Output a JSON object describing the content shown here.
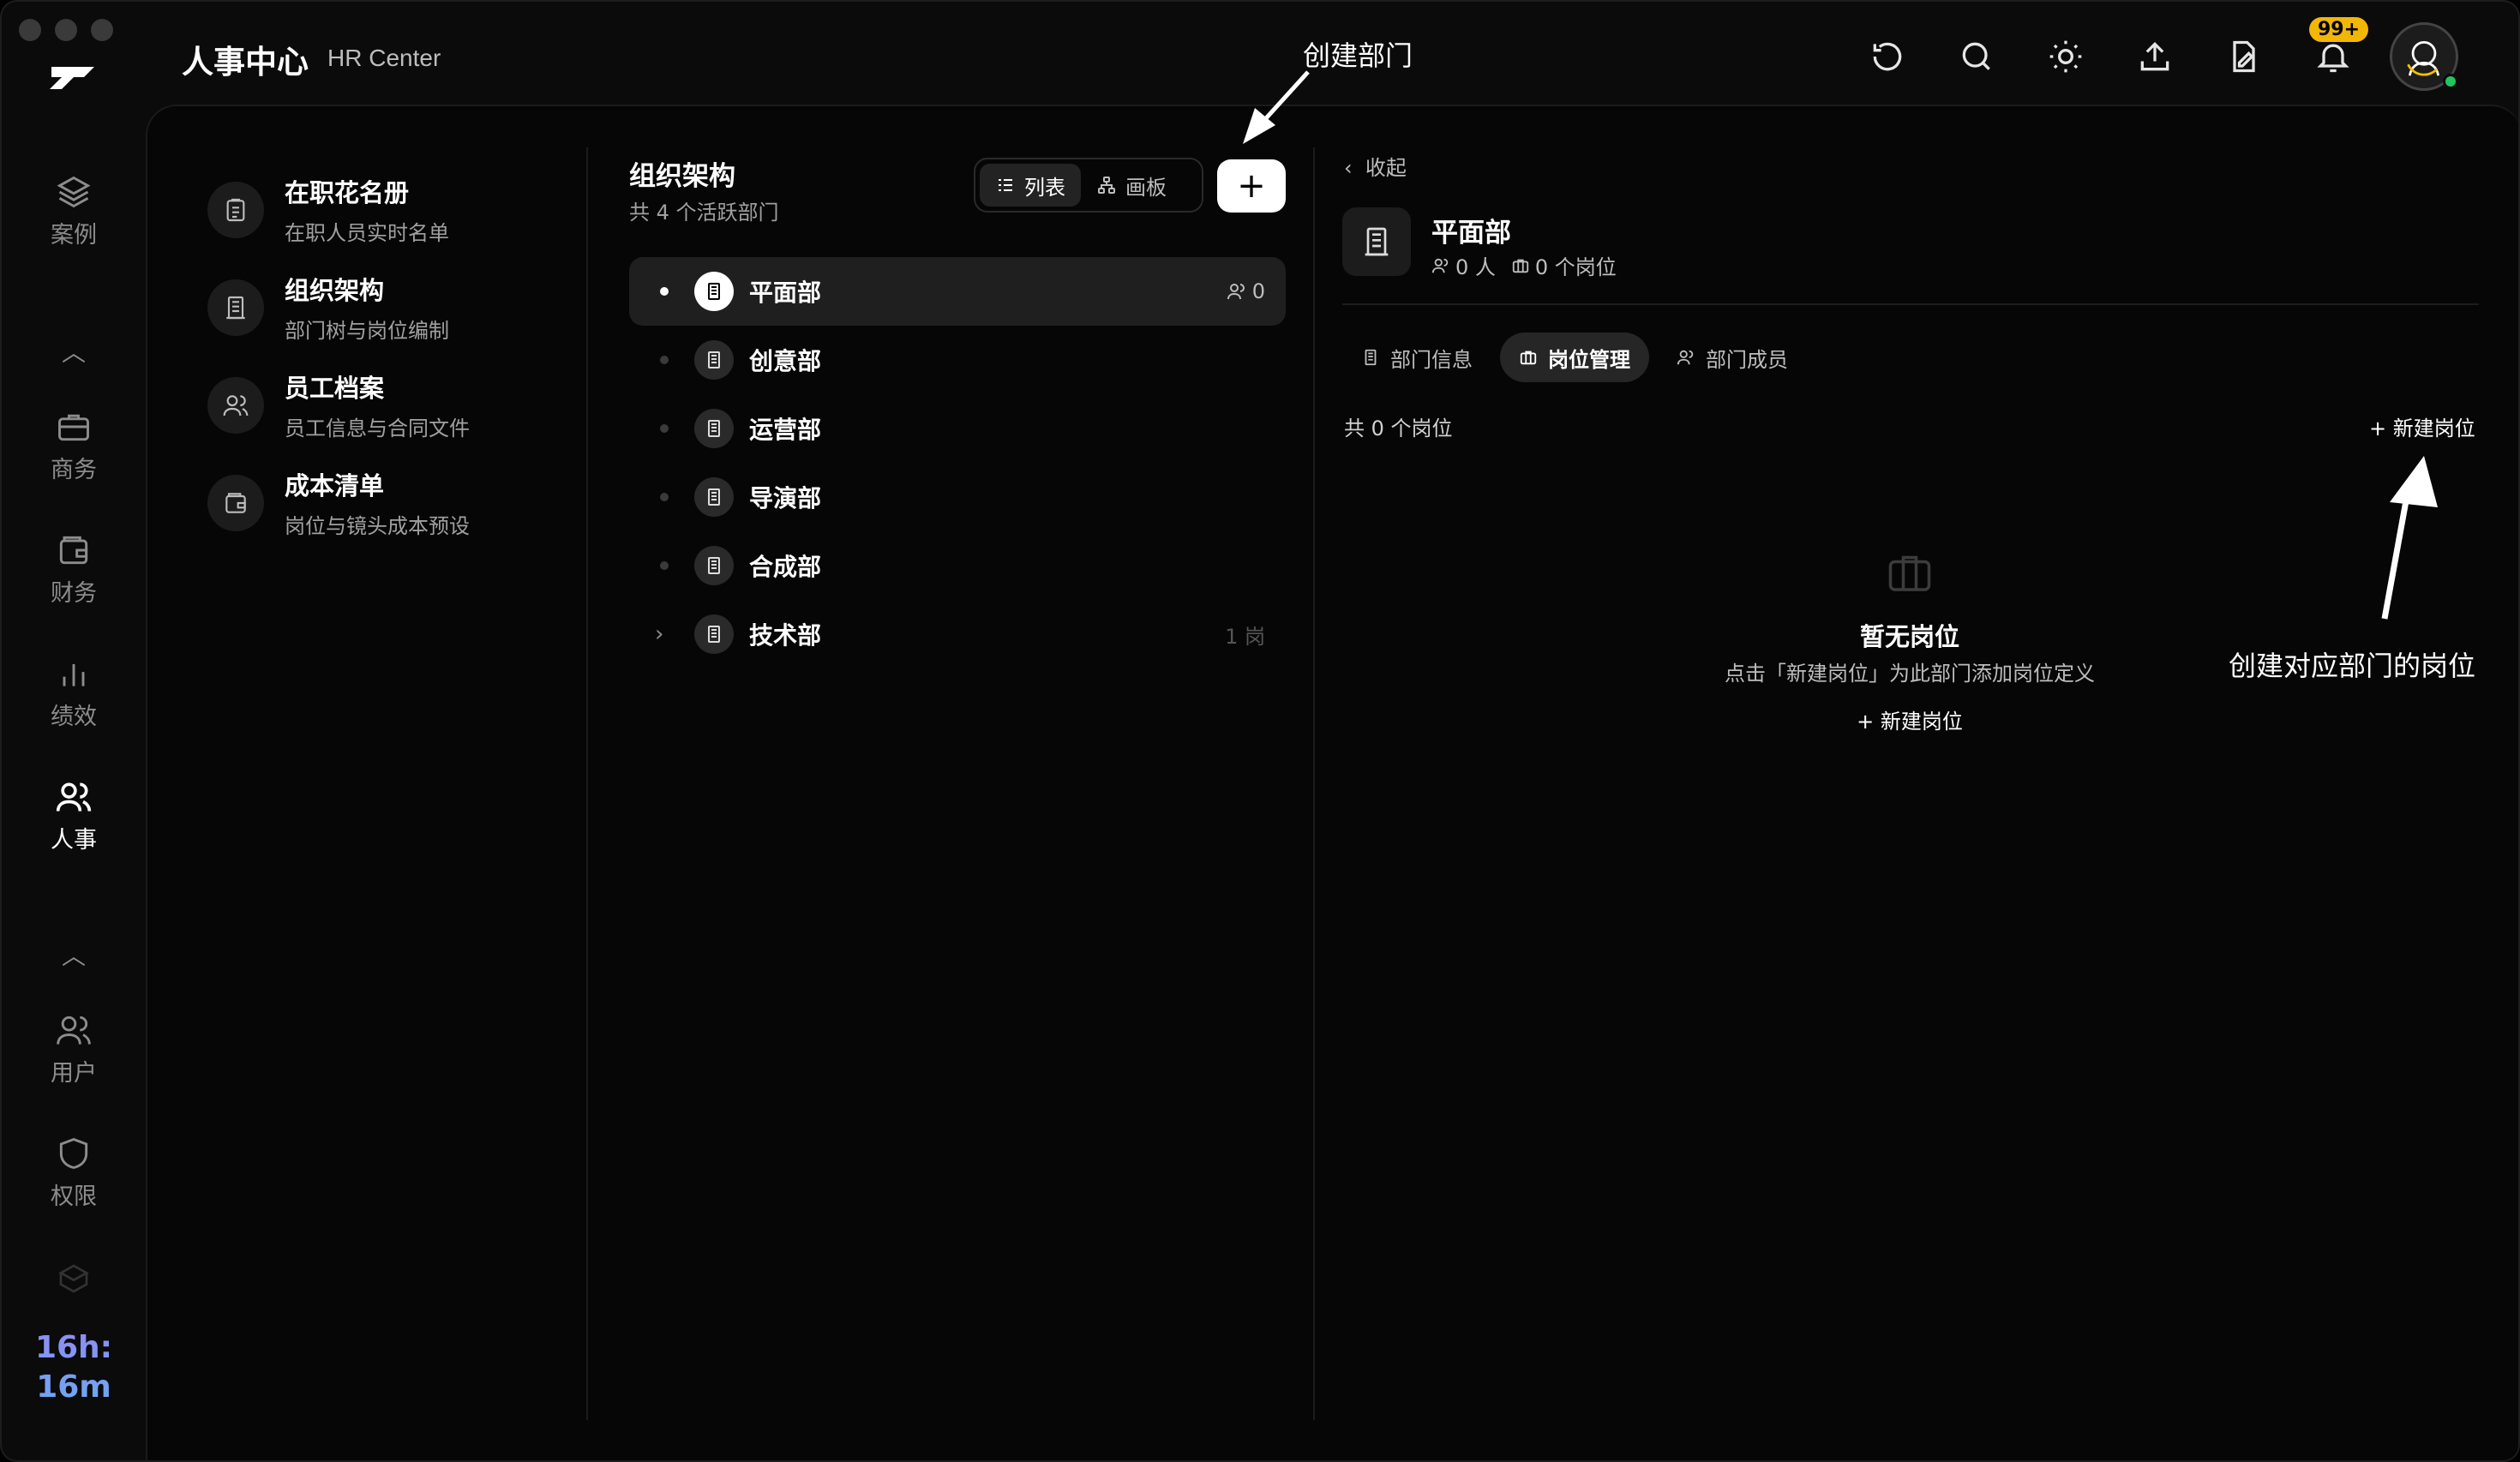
{
  "header": {
    "title": "人事中心",
    "subtitle": "HR Center",
    "notification_badge": "99+",
    "icons": [
      "refresh-icon",
      "search-icon",
      "sun-icon",
      "upload-icon",
      "file-sign-icon",
      "bell-icon"
    ]
  },
  "rail": {
    "items": [
      {
        "label": "案例",
        "icon": "layers-icon"
      },
      {
        "label": "商务",
        "icon": "briefcase-icon"
      },
      {
        "label": "财务",
        "icon": "wallet-icon"
      },
      {
        "label": "绩效",
        "icon": "bar-chart-icon"
      },
      {
        "label": "人事",
        "icon": "people-icon",
        "active": true
      },
      {
        "label": "用户",
        "icon": "users-icon"
      },
      {
        "label": "权限",
        "icon": "shield-icon"
      }
    ],
    "timer": [
      "16h:",
      "16m"
    ]
  },
  "subnav": {
    "items": [
      {
        "title": "在职花名册",
        "desc": "在职人员实时名单",
        "icon": "clipboard-icon"
      },
      {
        "title": "组织架构",
        "desc": "部门树与岗位编制",
        "icon": "building-icon"
      },
      {
        "title": "员工档案",
        "desc": "员工信息与合同文件",
        "icon": "users-icon"
      },
      {
        "title": "成本清单",
        "desc": "岗位与镜头成本预设",
        "icon": "wallet-icon"
      }
    ]
  },
  "org": {
    "title": "组织架构",
    "count": "共 4 个活跃部门",
    "view_list": "列表",
    "view_board": "画板",
    "add_label": "+",
    "departments": [
      {
        "name": "平面部",
        "meta": "0"
      },
      {
        "name": "创意部",
        "meta": ""
      },
      {
        "name": "运营部",
        "meta": ""
      },
      {
        "name": "导演部",
        "meta": ""
      },
      {
        "name": "合成部",
        "meta": ""
      },
      {
        "name": "技术部",
        "meta": "1 岗"
      }
    ]
  },
  "detail": {
    "collapse": "收起",
    "dept_name": "平面部",
    "people": "0 人",
    "positions": "0 个岗位",
    "tabs": [
      "部门信息",
      "岗位管理",
      "部门成员"
    ],
    "active_tab": "岗位管理",
    "pos_count": "共 0 个岗位",
    "new_pos": "+ 新建岗位",
    "empty_title": "暂无岗位",
    "empty_desc": "点击「新建岗位」为此部门添加岗位定义",
    "empty_btn": "+ 新建岗位"
  },
  "annotations": {
    "create_dept": "创建部门",
    "create_pos": "创建对应部门的岗位"
  }
}
